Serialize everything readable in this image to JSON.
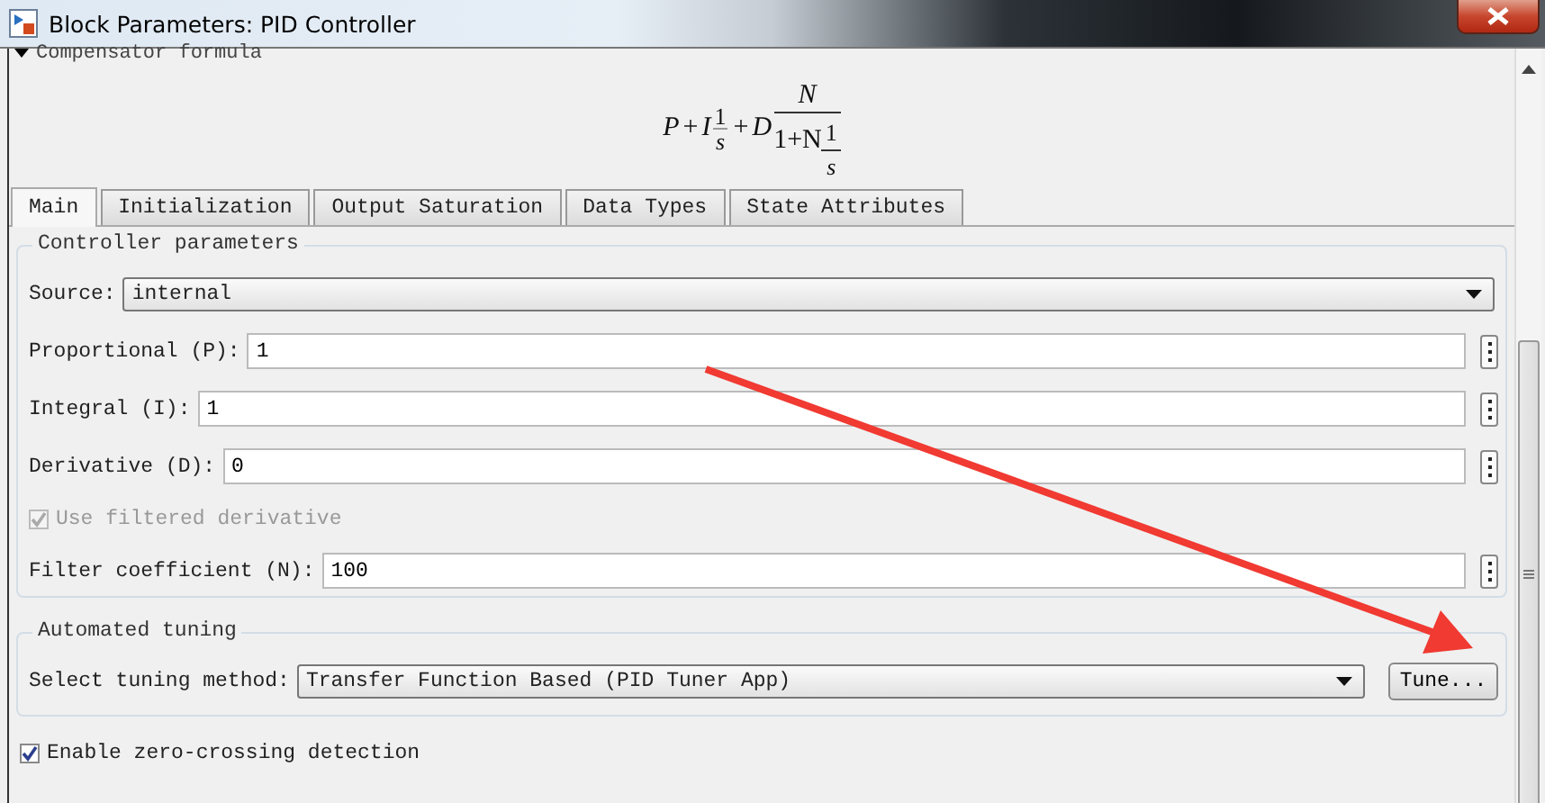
{
  "window": {
    "title": "Block Parameters: PID Controller"
  },
  "compensator": {
    "heading": "Compensator formula",
    "expanded": true,
    "formula": [
      {
        "kind": "sym",
        "text": "P"
      },
      {
        "kind": "op",
        "text": "+"
      },
      {
        "kind": "sym",
        "text": "I"
      },
      {
        "kind": "frac",
        "num": "1",
        "den": "s"
      },
      {
        "kind": "op",
        "text": "+"
      },
      {
        "kind": "sym",
        "text": "D"
      },
      {
        "kind": "bigfrac",
        "num": "N",
        "den": "1+N",
        "den_num": "1",
        "den_den": "s"
      }
    ]
  },
  "tabs": [
    {
      "label": "Main",
      "selected": true
    },
    {
      "label": "Initialization",
      "selected": false
    },
    {
      "label": "Output Saturation",
      "selected": false
    },
    {
      "label": "Data Types",
      "selected": false
    },
    {
      "label": "State Attributes",
      "selected": false
    }
  ],
  "groups": [
    {
      "title": "Controller parameters",
      "rows": [
        {
          "kind": "dropdown",
          "label": "Source:",
          "value": "internal"
        },
        {
          "kind": "field",
          "label": "Proportional (P):",
          "value": "1"
        },
        {
          "kind": "field",
          "label": "Integral (I):",
          "value": "1"
        },
        {
          "kind": "field",
          "label": "Derivative (D):",
          "value": "0"
        },
        {
          "kind": "checkbox",
          "label": "Use filtered derivative",
          "checked": true,
          "disabled": true
        },
        {
          "kind": "field",
          "label": "Filter coefficient (N):",
          "value": "100"
        }
      ]
    },
    {
      "title": "Automated tuning",
      "rows": [
        {
          "kind": "dropdown_button",
          "label": "Select tuning method:",
          "value": "Transfer Function Based (PID Tuner App)",
          "button": "Tune..."
        }
      ]
    }
  ],
  "options": [
    {
      "kind": "checkbox",
      "label": "Enable zero-crossing detection",
      "checked": true,
      "disabled": false
    }
  ]
}
